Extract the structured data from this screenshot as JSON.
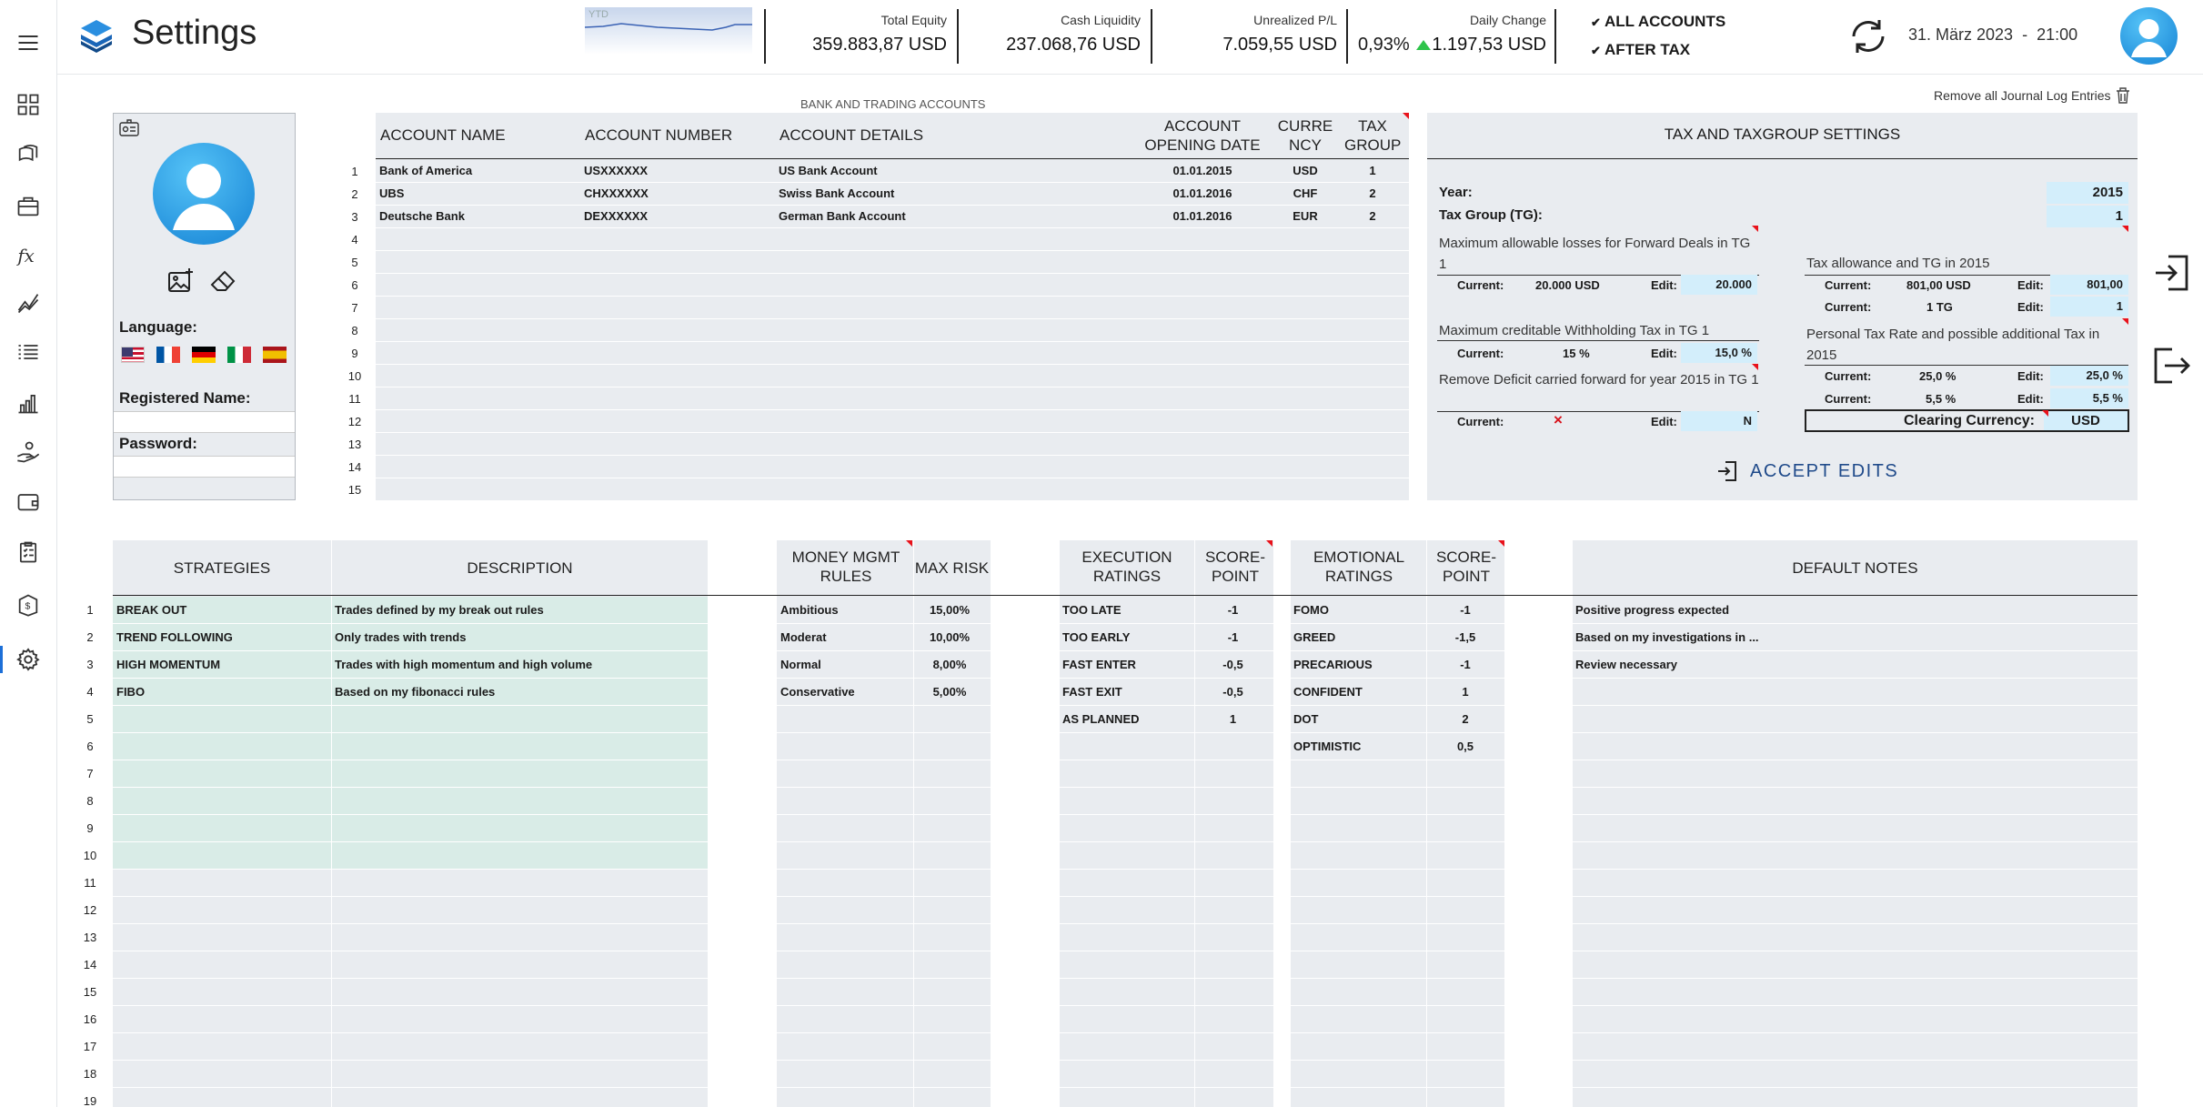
{
  "header": {
    "title": "Settings",
    "sparkline_label": "YTD",
    "stats": [
      {
        "label": "Total Equity",
        "value": "359.883,87 USD"
      },
      {
        "label": "Cash Liquidity",
        "value": "237.068,76 USD"
      },
      {
        "label": "Unrealized P/L",
        "value": "7.059,55 USD"
      },
      {
        "label": "Daily Change",
        "pct": "0,93%",
        "value": "1.197,53 USD"
      }
    ],
    "toggles": [
      "ALL ACCOUNTS",
      "AFTER TAX"
    ],
    "datetime": "31. März 2023  -  21:00"
  },
  "profile": {
    "language_label": "Language:",
    "registered_name_label": "Registered Name:",
    "password_label": "Password:",
    "flags": [
      "us-flag-icon",
      "fr-flag-icon",
      "de-flag-icon",
      "it-flag-icon",
      "es-flag-icon"
    ]
  },
  "accounts": {
    "caption": "BANK AND TRADING ACCOUNTS",
    "remove_link": "Remove all Journal Log Entries",
    "columns": [
      "ACCOUNT NAME",
      "ACCOUNT NUMBER",
      "ACCOUNT DETAILS",
      "ACCOUNT OPENING DATE",
      "CURRE NCY",
      "TAX GROUP"
    ],
    "rows": [
      {
        "num": "1",
        "name": "Bank of America",
        "number": "USXXXXXX",
        "details": "US Bank Account",
        "date": "01.01.2015",
        "ccy": "USD",
        "tg": "1"
      },
      {
        "num": "2",
        "name": "UBS",
        "number": "CHXXXXXX",
        "details": "Swiss Bank Account",
        "date": "01.01.2016",
        "ccy": "CHF",
        "tg": "2"
      },
      {
        "num": "3",
        "name": "Deutsche Bank",
        "number": "DEXXXXXX",
        "details": "German Bank Account",
        "date": "01.01.2016",
        "ccy": "EUR",
        "tg": "2"
      },
      {
        "num": "4"
      },
      {
        "num": "5"
      },
      {
        "num": "6"
      },
      {
        "num": "7"
      },
      {
        "num": "8"
      },
      {
        "num": "9"
      },
      {
        "num": "10"
      },
      {
        "num": "11"
      },
      {
        "num": "12"
      },
      {
        "num": "13"
      },
      {
        "num": "14"
      },
      {
        "num": "15"
      }
    ]
  },
  "tax": {
    "title": "TAX AND TAXGROUP SETTINGS",
    "year_label": "Year:",
    "year_value": "2015",
    "tg_label": "Tax Group (TG):",
    "tg_value": "1",
    "max_loss_label": "Maximum allowable losses for Forward Deals in TG 1",
    "max_loss_current": "20.000 USD",
    "max_loss_edit": "20.000",
    "withholding_label": "Maximum creditable Withholding Tax in TG 1",
    "withholding_current": "15 %",
    "withholding_edit": "15,0 %",
    "deficit_label": "Remove Deficit carried forward for year 2015 in TG 1",
    "deficit_current": "×",
    "deficit_edit": "N",
    "allowance_label": "Tax allowance and TG in 2015",
    "allowance_current": "801,00 USD",
    "allowance_edit": "801,00",
    "allowance_tg_current": "1 TG",
    "allowance_tg_edit": "1",
    "rate_label": "Personal Tax Rate and possible additional Tax in 2015",
    "rate_current": "25,0 %",
    "rate_edit": "25,0 %",
    "add_current": "5,5 %",
    "add_edit": "5,5 %",
    "clearing_label": "Clearing Currency:",
    "clearing_value": "USD",
    "current_label": "Current:",
    "edit_label": "Edit:",
    "accept": "ACCEPT EDITS"
  },
  "strategies": {
    "col1": "STRATEGIES",
    "col2": "DESCRIPTION",
    "rows": [
      {
        "name": "BREAK OUT",
        "desc": "Trades defined by my break out rules"
      },
      {
        "name": "TREND FOLLOWING",
        "desc": "Only trades with trends"
      },
      {
        "name": "HIGH MOMENTUM",
        "desc": "Trades with high momentum and high volume"
      },
      {
        "name": "FIBO",
        "desc": "Based on my fibonacci rules"
      }
    ],
    "row_numbers": [
      "1",
      "2",
      "3",
      "4",
      "5",
      "6",
      "7",
      "8",
      "9",
      "10",
      "11",
      "12",
      "13",
      "14",
      "15",
      "16",
      "17",
      "18",
      "19"
    ]
  },
  "money": {
    "col1": "MONEY MGMT RULES",
    "col2": "MAX RISK",
    "rows": [
      {
        "name": "Ambitious",
        "risk": "15,00%"
      },
      {
        "name": "Moderat",
        "risk": "10,00%"
      },
      {
        "name": "Normal",
        "risk": "8,00%"
      },
      {
        "name": "Conservative",
        "risk": "5,00%"
      }
    ]
  },
  "execution": {
    "col1": "EXECUTION RATINGS",
    "col2": "SCORE-POINT",
    "rows": [
      {
        "name": "TOO LATE",
        "score": "-1"
      },
      {
        "name": "TOO EARLY",
        "score": "-1"
      },
      {
        "name": "FAST ENTER",
        "score": "-0,5"
      },
      {
        "name": "FAST EXIT",
        "score": "-0,5"
      },
      {
        "name": "AS PLANNED",
        "score": "1"
      }
    ]
  },
  "emotional": {
    "col1": "EMOTIONAL RATINGS",
    "col2": "SCORE-POINT",
    "rows": [
      {
        "name": "FOMO",
        "score": "-1"
      },
      {
        "name": "GREED",
        "score": "-1,5"
      },
      {
        "name": "PRECARIOUS",
        "score": "-1"
      },
      {
        "name": "CONFIDENT",
        "score": "1"
      },
      {
        "name": "DOT",
        "score": "2"
      },
      {
        "name": "OPTIMISTIC",
        "score": "0,5"
      }
    ]
  },
  "notes": {
    "title": "DEFAULT NOTES",
    "rows": [
      "Positive progress expected",
      "Based on my investigations in ...",
      "Review necessary"
    ]
  },
  "colors": {
    "accent": "#1c6fd8",
    "panel": "#e9ecf0",
    "green_cell": "#d9ece7",
    "edit_cell": "#d3eefb",
    "up_arrow": "#2ec44a",
    "marker": "#e8121b"
  }
}
